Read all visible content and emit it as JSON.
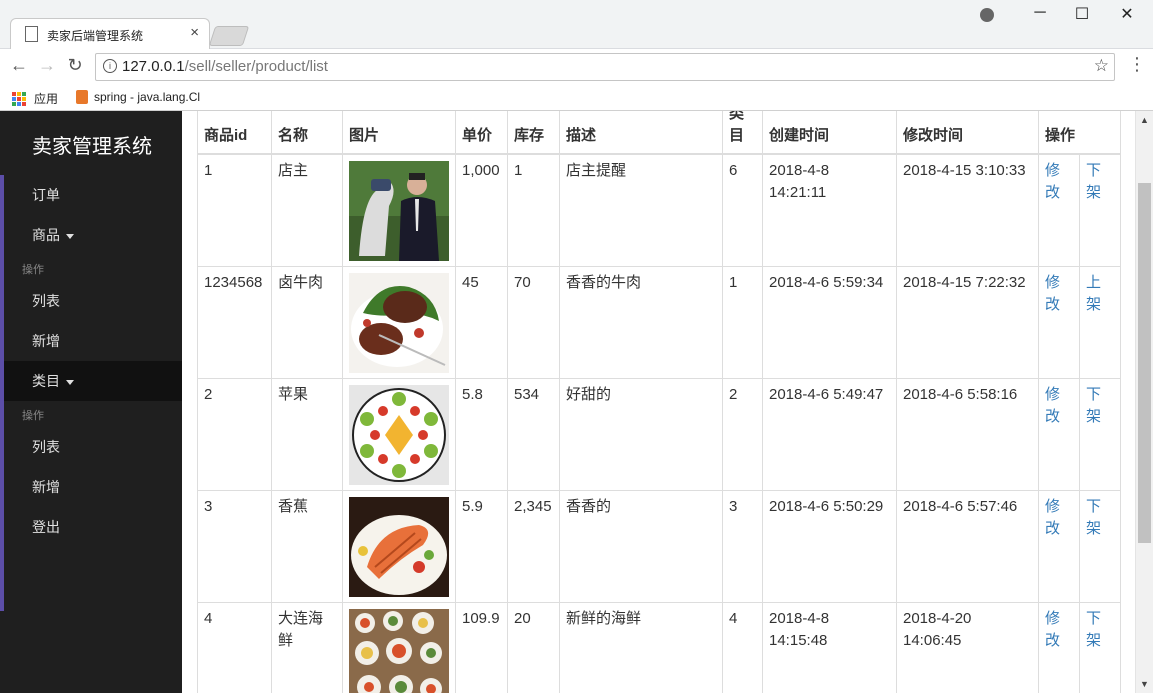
{
  "browser": {
    "tab_title": "卖家后端管理系统",
    "tab_close": "×",
    "url_host": "127.0.0.1",
    "url_path": "/sell/seller/product/list",
    "bookmarks": {
      "apps_label": "应用",
      "item_label": "spring - java.lang.Cl"
    },
    "controls": {
      "minimize": "─",
      "maximize": "☐",
      "close": "✕",
      "back": "←",
      "forward": "→",
      "reload": "↻",
      "star": "☆",
      "menu": "⋮",
      "info": "i"
    }
  },
  "sidebar": {
    "brand": "卖家管理系统",
    "items": [
      {
        "label": "订单"
      },
      {
        "label": "商品"
      },
      {
        "header": "操作"
      },
      {
        "label": "列表"
      },
      {
        "label": "新增"
      },
      {
        "label": "类目"
      },
      {
        "header": "操作"
      },
      {
        "label": "列表"
      },
      {
        "label": "新增"
      },
      {
        "label": "登出"
      }
    ]
  },
  "table": {
    "headers": [
      "商品id",
      "名称",
      "图片",
      "单价",
      "库存",
      "描述",
      "类目",
      "创建时间",
      "修改时间",
      "操作"
    ],
    "rows": [
      {
        "id": "1",
        "name": "店主",
        "price": "1,000",
        "stock": "1",
        "desc": "店主提醒",
        "category": "6",
        "created": "2018-4-8 14:21:11",
        "modified": "2018-4-15 3:10:33",
        "edit": "修改",
        "toggle": "下架",
        "image": "man-with-horse"
      },
      {
        "id": "1234568",
        "name": "卤牛肉",
        "price": "45",
        "stock": "70",
        "desc": "香香的牛肉",
        "category": "1",
        "created": "2018-4-6 5:59:34",
        "modified": "2018-4-15 7:22:32",
        "edit": "修改",
        "toggle": "上架",
        "image": "steak-salad"
      },
      {
        "id": "2",
        "name": "苹果",
        "price": "5.8",
        "stock": "534",
        "desc": "好甜的",
        "category": "2",
        "created": "2018-4-6 5:49:47",
        "modified": "2018-4-6 5:58:16",
        "edit": "修改",
        "toggle": "下架",
        "image": "fruit-plate"
      },
      {
        "id": "3",
        "name": "香蕉",
        "price": "5.9",
        "stock": "2,345",
        "desc": "香香的",
        "category": "3",
        "created": "2018-4-6 5:50:29",
        "modified": "2018-4-6 5:57:46",
        "edit": "修改",
        "toggle": "下架",
        "image": "salmon-dish"
      },
      {
        "id": "4",
        "name": "大连海鲜",
        "price": "109.9",
        "stock": "20",
        "desc": "新鲜的海鲜",
        "category": "4",
        "created": "2018-4-8 14:15:48",
        "modified": "2018-4-20 14:06:45",
        "edit": "修改",
        "toggle": "下架",
        "image": "seafood-spread"
      }
    ]
  },
  "colors": {
    "sidebar_bg": "#1f1f1f",
    "link": "#337ab7",
    "accent": "#5c4ea8"
  }
}
